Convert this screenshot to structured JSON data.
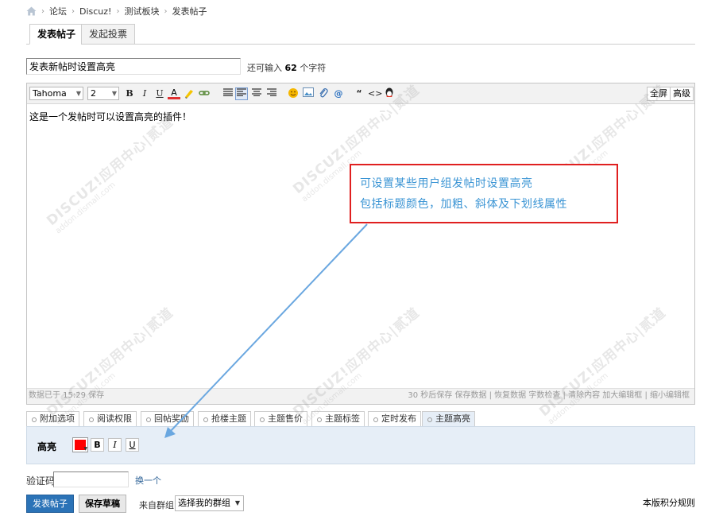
{
  "breadcrumb": {
    "items": [
      "论坛",
      "Discuz!",
      "测试板块",
      "发表帖子"
    ],
    "separator": "›"
  },
  "tabs": [
    {
      "label": "发表帖子"
    },
    {
      "label": "发起投票"
    }
  ],
  "subject": {
    "value": "发表新帖时设置高亮",
    "remaining_prefix": "还可输入",
    "remaining_count": "62",
    "remaining_suffix": "个字符"
  },
  "editor": {
    "font": "Tahoma",
    "size": "2",
    "fullscreen_label": "全屏",
    "advanced_label": "高级",
    "content": "这是一个发帖时可以设置高亮的插件！",
    "status_left": "数据已于 15:29 保存",
    "status_right": "30 秒后保存  保存数据 | 恢复数据    字数检查 | 清除内容    加大编辑框 | 缩小编辑框",
    "buttons": {
      "bold": "B",
      "italic": "I",
      "underline": "U",
      "color": "A",
      "quote": "“",
      "code": "<>"
    }
  },
  "extra_tabs": [
    {
      "label": "附加选项"
    },
    {
      "label": "阅读权限"
    },
    {
      "label": "回帖奖励"
    },
    {
      "label": "抢楼主题"
    },
    {
      "label": "主题售价"
    },
    {
      "label": "主题标签"
    },
    {
      "label": "定时发布"
    },
    {
      "label": "主题高亮"
    }
  ],
  "highlight": {
    "label": "高亮",
    "color": "#ff0000",
    "bold": "B",
    "italic": "I",
    "underline": "U"
  },
  "captcha": {
    "label": "验证码",
    "refresh": "换一个"
  },
  "actions": {
    "submit": "发表帖子",
    "draft": "保存草稿",
    "group_label": "来自群组:",
    "group_select": "选择我的群组"
  },
  "rules_link": "本版积分规则",
  "annotation": {
    "line1": "可设置某些用户组发帖时设置高亮",
    "line2": "包括标题颜色，加粗、斜体及下划线属性",
    "border_color": "#e02020",
    "text_color": "#3a94d4"
  },
  "watermark": {
    "brand": "DISCUZ!应用中心|贰道",
    "url": "addon.dismall.com"
  }
}
